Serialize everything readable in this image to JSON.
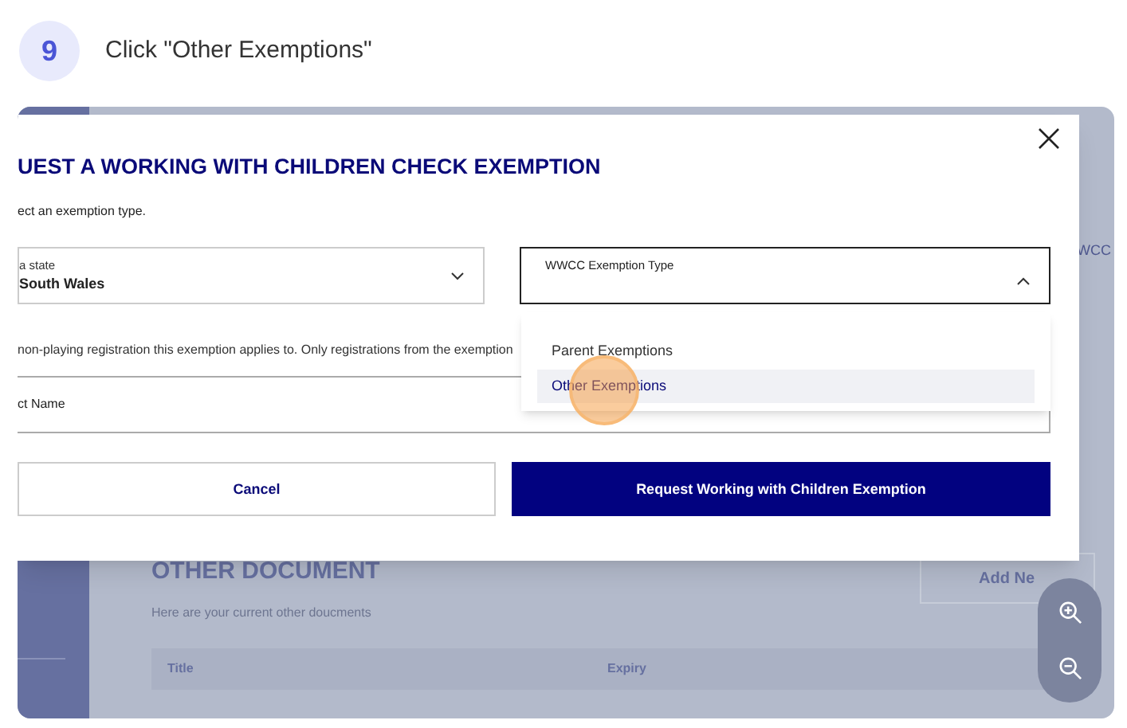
{
  "step": {
    "number": "9",
    "instruction": "Click \"Other Exemptions\""
  },
  "background": {
    "column_label": "WCC",
    "section_title": "OTHER DOCUMENT",
    "section_subtitle": "Here are your current other doucments",
    "add_button": "Add Ne",
    "columns": [
      "Title",
      "Expiry"
    ]
  },
  "modal": {
    "title": "UEST A WORKING WITH CHILDREN CHECK EXEMPTION",
    "subtitle": "ect an exemption type.",
    "state_field": {
      "label": "a state",
      "value": "South Wales"
    },
    "type_field": {
      "label": "WWCC Exemption Type",
      "expanded": true,
      "options": [
        {
          "label": "Parent Exemptions",
          "selected": false
        },
        {
          "label": "Other Exemptions",
          "selected": true
        }
      ]
    },
    "note": "non-playing registration this exemption applies to. Only registrations from the exemption",
    "name_field": {
      "label": "ct Name"
    },
    "buttons": [
      {
        "label": "Cancel",
        "kind": "secondary"
      },
      {
        "label": "Request Working with Children Exemption",
        "kind": "primary"
      }
    ]
  }
}
